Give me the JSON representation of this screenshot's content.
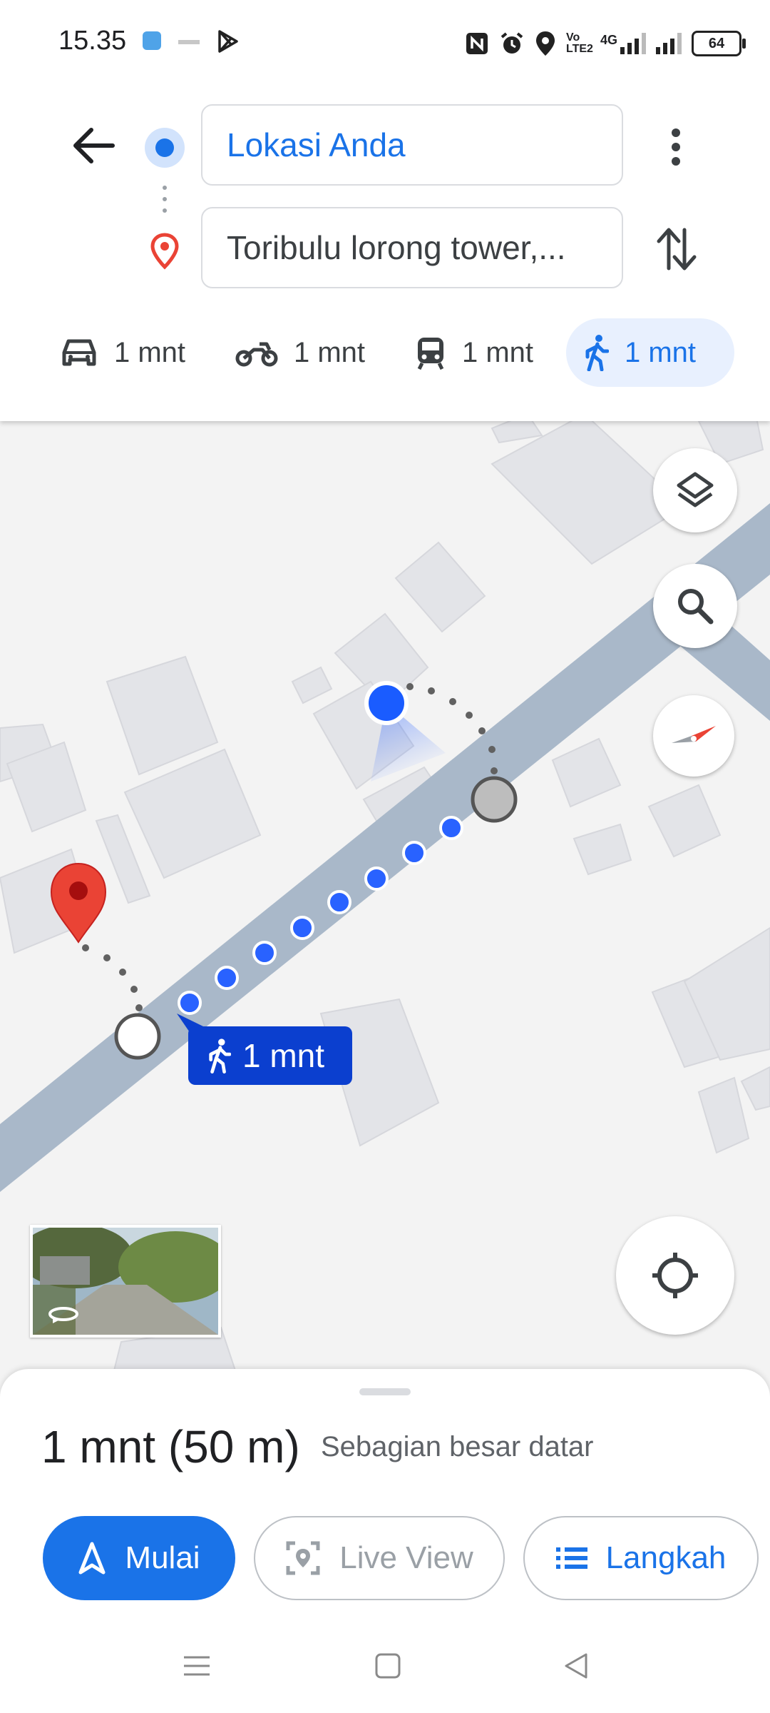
{
  "status_bar": {
    "time": "15.35",
    "network_label": "4G",
    "volte_label": "Vo LTE2",
    "battery": "64"
  },
  "header": {
    "origin": "Lokasi Anda",
    "destination": "Toribulu lorong tower,...",
    "modes": [
      {
        "name": "car",
        "label": "1 mnt"
      },
      {
        "name": "motorcycle",
        "label": "1 mnt"
      },
      {
        "name": "transit",
        "label": "1 mnt"
      },
      {
        "name": "walk",
        "label": "1 mnt",
        "active": true
      }
    ]
  },
  "map": {
    "route_badge": "1 mnt",
    "accent_color": "#1a73e8",
    "route_color": "#2962ff",
    "destination_pin_color": "#ea4335"
  },
  "sheet": {
    "duration_distance": "1 mnt (50 m)",
    "terrain_note": "Sebagian besar datar",
    "start_label": "Mulai",
    "live_view_label": "Live View",
    "steps_label": "Langkah"
  }
}
